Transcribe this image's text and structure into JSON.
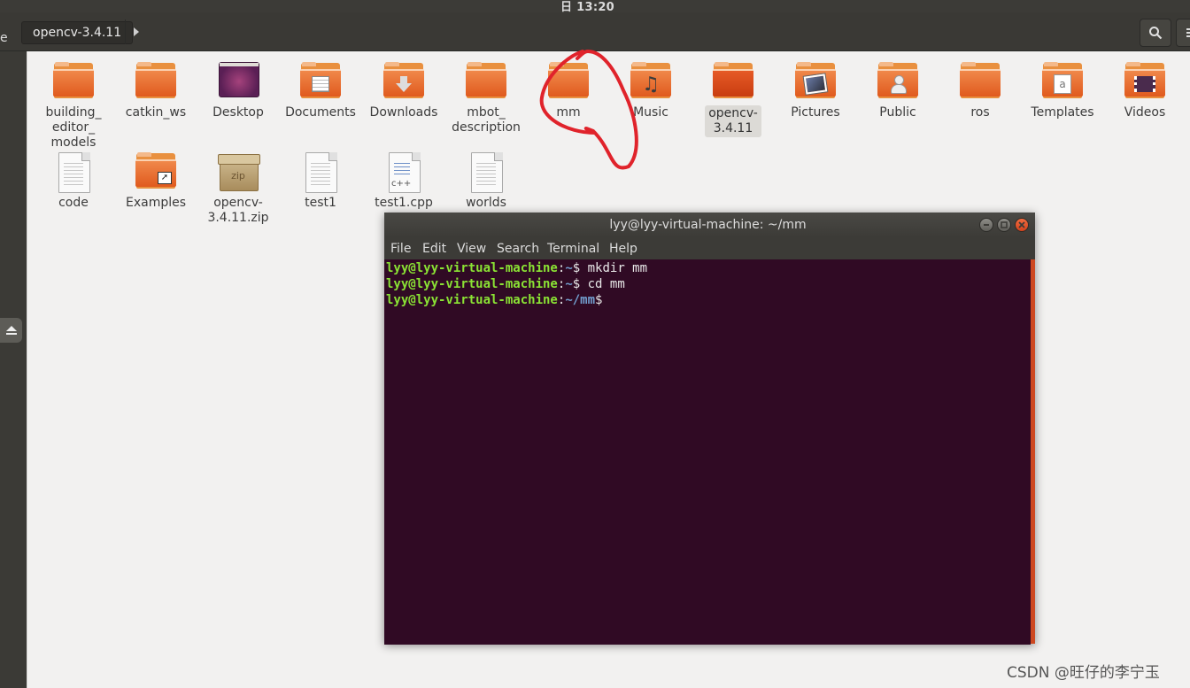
{
  "topbar": {
    "clock": "日 13:20"
  },
  "headerbar": {
    "edge_label": "e",
    "breadcrumb": "opencv-3.4.11",
    "search_icon": "search-icon",
    "menu_icon": "hamburger-menu-icon"
  },
  "sidebar": {
    "eject_icon": "eject-icon"
  },
  "files": [
    {
      "label": "building_\neditor_\nmodels",
      "kind": "folder",
      "icon": "folder-icon"
    },
    {
      "label": "catkin_ws",
      "kind": "folder",
      "icon": "folder-icon"
    },
    {
      "label": "Desktop",
      "kind": "desktop",
      "icon": "desktop-folder-icon"
    },
    {
      "label": "Documents",
      "kind": "folder",
      "icon": "documents-folder-icon"
    },
    {
      "label": "Downloads",
      "kind": "folder",
      "icon": "downloads-folder-icon"
    },
    {
      "label": "mbot_\ndescription",
      "kind": "folder",
      "icon": "folder-icon"
    },
    {
      "label": "mm",
      "kind": "folder",
      "icon": "folder-icon"
    },
    {
      "label": "Music",
      "kind": "folder",
      "icon": "music-folder-icon"
    },
    {
      "label": "opencv-\n3.4.11",
      "kind": "folder",
      "icon": "folder-icon",
      "selected": true
    },
    {
      "label": "Pictures",
      "kind": "folder",
      "icon": "pictures-folder-icon"
    },
    {
      "label": "Public",
      "kind": "folder",
      "icon": "public-folder-icon"
    },
    {
      "label": "ros",
      "kind": "folder",
      "icon": "folder-icon"
    },
    {
      "label": "Templates",
      "kind": "folder",
      "icon": "templates-folder-icon"
    },
    {
      "label": "Videos",
      "kind": "folder",
      "icon": "videos-folder-icon"
    },
    {
      "label": "code",
      "kind": "doc",
      "icon": "text-file-icon"
    },
    {
      "label": "Examples",
      "kind": "folder",
      "icon": "symlink-folder-icon"
    },
    {
      "label": "opencv-\n3.4.11.zip",
      "kind": "zip",
      "icon": "zip-archive-icon"
    },
    {
      "label": "test1",
      "kind": "doc",
      "icon": "text-file-icon"
    },
    {
      "label": "test1.cpp",
      "kind": "cpp",
      "icon": "cpp-file-icon"
    },
    {
      "label": "worlds",
      "kind": "doc",
      "icon": "text-file-icon"
    }
  ],
  "terminal": {
    "title": "lyy@lyy-virtual-machine: ~/mm",
    "menu": [
      "File",
      "Edit",
      "View",
      "Search",
      "Terminal",
      "Help"
    ],
    "lines": [
      {
        "user": "lyy@lyy-virtual-machine",
        "path": "~",
        "prompt": "$ ",
        "command": "mkdir mm"
      },
      {
        "user": "lyy@lyy-virtual-machine",
        "path": "~",
        "prompt": "$ ",
        "command": "cd mm"
      },
      {
        "user": "lyy@lyy-virtual-machine",
        "path": "~/mm",
        "prompt": "$",
        "command": ""
      }
    ]
  },
  "annotation_color": "#e0232b",
  "watermark": "CSDN @旺仔的李宁玉"
}
